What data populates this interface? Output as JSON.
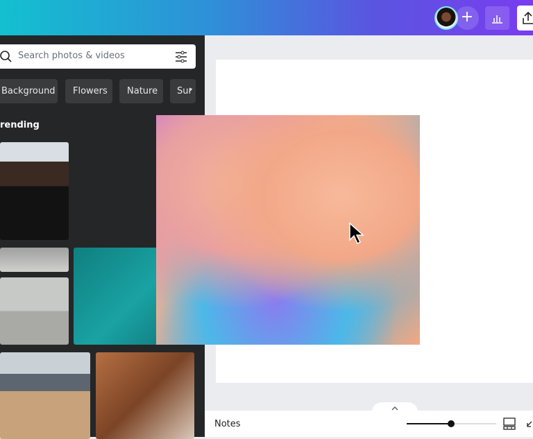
{
  "header": {
    "add_label": "+",
    "colors": {
      "gradient_start": "#13c0d0",
      "gradient_end": "#7a3cf0"
    }
  },
  "panel": {
    "search": {
      "placeholder": "Search photos & videos"
    },
    "chips": [
      "Background",
      "Flowers",
      "Nature",
      "Sur"
    ],
    "section_title": "rending"
  },
  "bottom_bar": {
    "notes_label": "Notes",
    "zoom_fraction": 0.5
  }
}
